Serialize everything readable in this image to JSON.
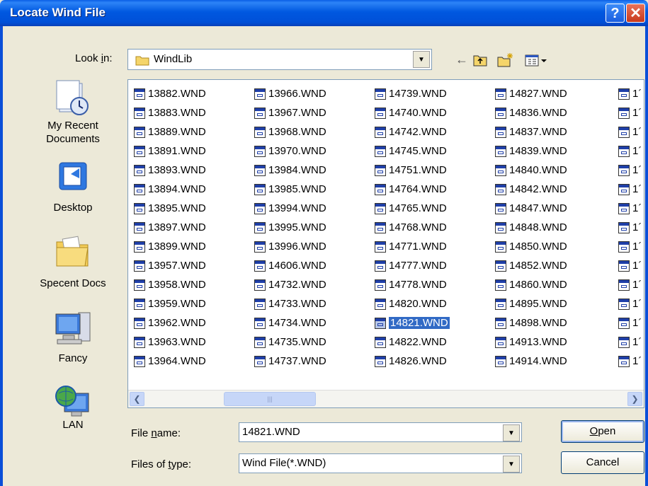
{
  "window": {
    "title": "Locate Wind File"
  },
  "lookin": {
    "label_pre": "Look ",
    "label_key": "i",
    "label_post": "n:",
    "value": "WindLib"
  },
  "places": [
    {
      "name": "my-recent-documents",
      "label": "My Recent Documents",
      "icon": "recent-documents-icon"
    },
    {
      "name": "desktop",
      "label": "Desktop",
      "icon": "desktop-icon"
    },
    {
      "name": "specent-docs",
      "label": "Specent Docs",
      "icon": "folder-icon"
    },
    {
      "name": "fancy",
      "label": "Fancy",
      "icon": "computer-icon"
    },
    {
      "name": "lan",
      "label": "LAN",
      "icon": "network-icon"
    }
  ],
  "files": {
    "col1": [
      "13882.WND",
      "13883.WND",
      "13889.WND",
      "13891.WND",
      "13893.WND",
      "13894.WND",
      "13895.WND",
      "13897.WND",
      "13899.WND",
      "13957.WND",
      "13958.WND",
      "13959.WND",
      "13962.WND",
      "13963.WND",
      "13964.WND"
    ],
    "col2": [
      "13966.WND",
      "13967.WND",
      "13968.WND",
      "13970.WND",
      "13984.WND",
      "13985.WND",
      "13994.WND",
      "13995.WND",
      "13996.WND",
      "14606.WND",
      "14732.WND",
      "14733.WND",
      "14734.WND",
      "14735.WND",
      "14737.WND"
    ],
    "col3": [
      "14739.WND",
      "14740.WND",
      "14742.WND",
      "14745.WND",
      "14751.WND",
      "14764.WND",
      "14765.WND",
      "14768.WND",
      "14771.WND",
      "14777.WND",
      "14778.WND",
      "14820.WND",
      "14821.WND",
      "14822.WND",
      "14826.WND"
    ],
    "col4": [
      "14827.WND",
      "14836.WND",
      "14837.WND",
      "14839.WND",
      "14840.WND",
      "14842.WND",
      "14847.WND",
      "14848.WND",
      "14850.WND",
      "14852.WND",
      "14860.WND",
      "14895.WND",
      "14898.WND",
      "14913.WND",
      "14914.WND"
    ],
    "col5_partial": [
      "1´",
      "1´",
      "1´",
      "1´",
      "1´",
      "1´",
      "1´",
      "1´",
      "1´",
      "1´",
      "1´",
      "1´",
      "1´",
      "1´",
      "1´"
    ],
    "selected": "14821.WND"
  },
  "filename": {
    "label_pre": "File ",
    "label_key": "n",
    "label_post": "ame:",
    "value": "14821.WND"
  },
  "filetype": {
    "label_pre": "Files of ",
    "label_key": "t",
    "label_post": "ype:",
    "value": "Wind File(*.WND)"
  },
  "buttons": {
    "open_key": "O",
    "open_rest": "pen",
    "cancel": "Cancel"
  },
  "colors": {
    "titlebar": "#0058e0",
    "selection": "#316ac5"
  }
}
